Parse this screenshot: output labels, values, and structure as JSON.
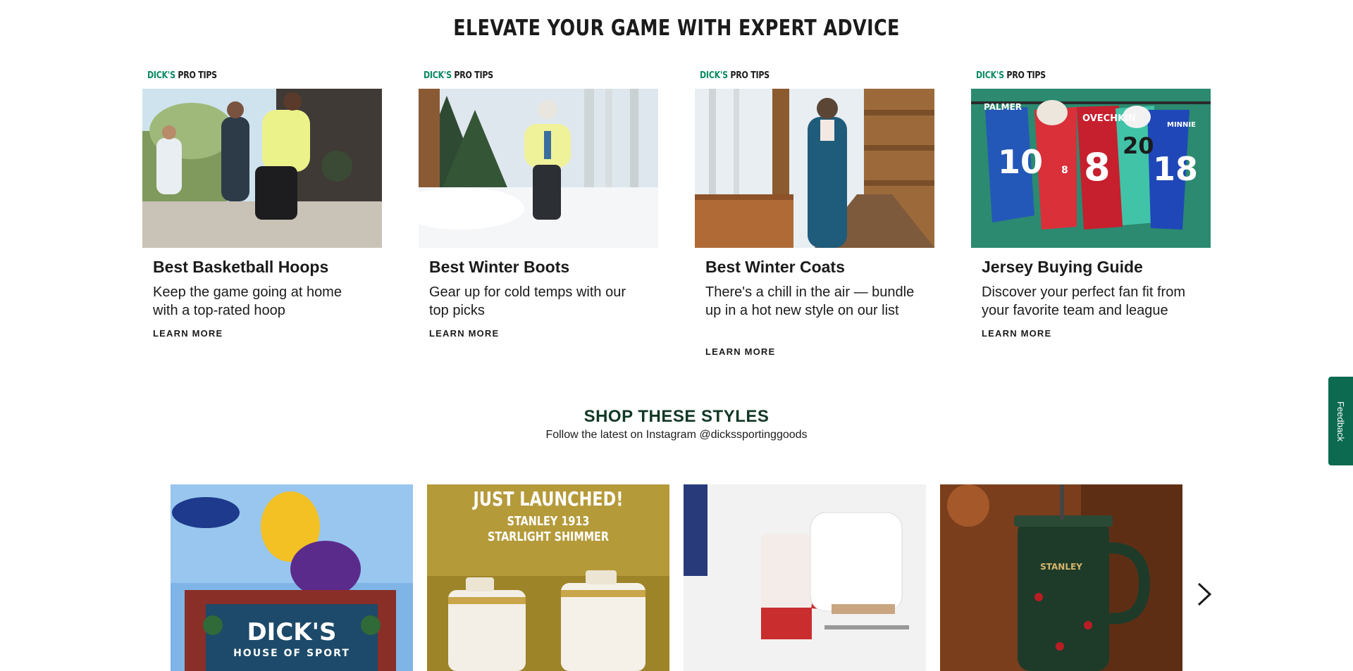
{
  "advice": {
    "heading": "ELEVATE YOUR GAME WITH EXPERT ADVICE",
    "badge_brand": "DICK'S",
    "badge_tips": "PRO TIPS",
    "cards": [
      {
        "title": "Best Basketball Hoops",
        "description": "Keep the game going at home with a top-rated hoop",
        "cta": "LEARN MORE"
      },
      {
        "title": "Best Winter Boots",
        "description": "Gear up for cold temps with our top picks",
        "cta": "LEARN MORE"
      },
      {
        "title": "Best Winter Coats",
        "description": "There's a chill in the air — bundle up in a hot new style on our list",
        "cta": "LEARN MORE"
      },
      {
        "title": "Jersey Buying Guide",
        "description": "Discover your perfect fan fit from your favorite team and league",
        "cta": "LEARN MORE"
      }
    ]
  },
  "shop": {
    "heading": "SHOP THESE STYLES",
    "subheading": "Follow the latest on Instagram @dickssportinggoods",
    "tiles": [
      {
        "store_name": "DICK'S",
        "store_sub": "HOUSE OF SPORT"
      },
      {
        "headline": "JUST LAUNCHED!",
        "line1": "STANLEY 1913",
        "line2": "STARLIGHT SHIMMER"
      },
      {},
      {
        "brand": "STANLEY"
      }
    ]
  },
  "feedback": {
    "label": "Feedback"
  },
  "jersey_numbers": [
    "10",
    "8",
    "20",
    "18"
  ],
  "jersey_names": [
    "PALMER",
    "OVECHKIN",
    "MINNIE"
  ],
  "colors": {
    "brand_green": "#0a8a64",
    "feedback_green": "#0b6a4f",
    "shop_heading": "#123826"
  },
  "icons": {
    "next": "chevron-right-icon"
  }
}
